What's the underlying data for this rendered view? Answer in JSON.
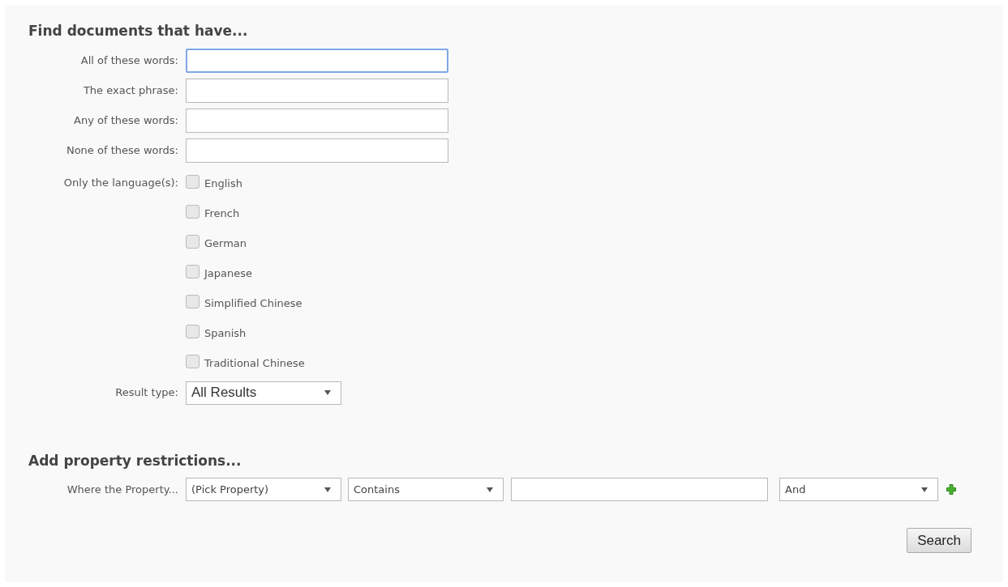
{
  "find_section": {
    "heading": "Find documents that have...",
    "fields": [
      {
        "label": "All of these words:",
        "focused": true
      },
      {
        "label": "The exact phrase:",
        "focused": false
      },
      {
        "label": "Any of these words:",
        "focused": false
      },
      {
        "label": "None of these words:",
        "focused": false
      }
    ],
    "languages": {
      "label": "Only the language(s):",
      "options": [
        {
          "label": "English",
          "checked": false
        },
        {
          "label": "French",
          "checked": false
        },
        {
          "label": "German",
          "checked": false
        },
        {
          "label": "Japanese",
          "checked": false
        },
        {
          "label": "Simplified Chinese",
          "checked": false
        },
        {
          "label": "Spanish",
          "checked": false
        },
        {
          "label": "Traditional Chinese",
          "checked": false
        }
      ]
    },
    "result_type": {
      "label": "Result type:",
      "value": "All Results"
    }
  },
  "property_section": {
    "heading": "Add property restrictions...",
    "row_label": "Where the Property...",
    "property": "(Pick Property)",
    "operator": "Contains",
    "connector": "And"
  },
  "search_button": "Search"
}
